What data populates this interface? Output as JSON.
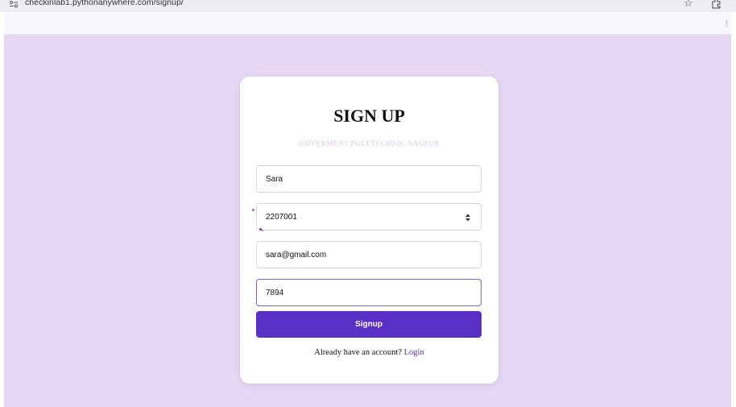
{
  "browser": {
    "url": "checkinlab1.pythonanywhere.com/signup/",
    "icons": [
      "site-settings-icon",
      "star-icon",
      "extensions-icon"
    ]
  },
  "page": {
    "background_color": "#e6d7f5",
    "title": "SIGN UP",
    "subtitle": "GOVERMENT POLYTECHNIC NAGPUR"
  },
  "form": {
    "name_value": "Sara",
    "roll_value": "2207001",
    "email_value": "sara@gmail.com",
    "password_value": "7894",
    "submit_label": "Signup",
    "accent_color": "#5a2fc6"
  },
  "footer": {
    "prompt": "Already have an account?",
    "link_label": "Login"
  }
}
